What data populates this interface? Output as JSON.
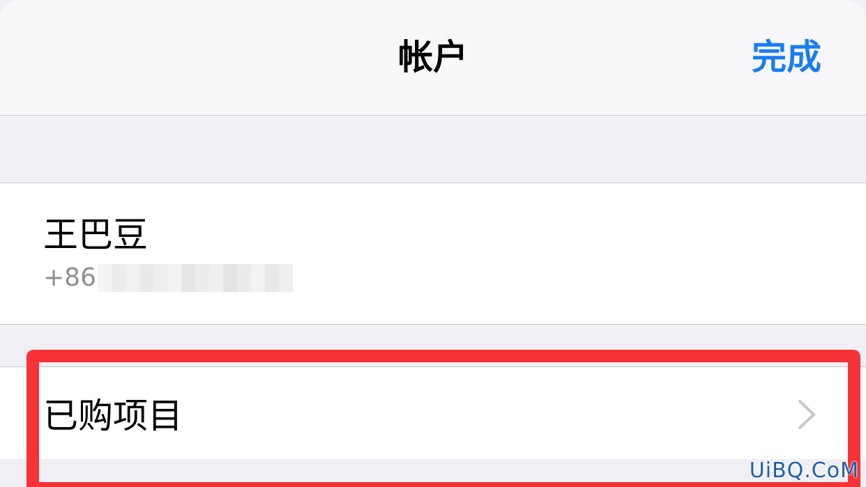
{
  "navbar": {
    "title": "帐户",
    "done_label": "完成"
  },
  "account": {
    "name": "王巴豆",
    "phone_prefix": "+86"
  },
  "purchased": {
    "label": "已购项目",
    "chevron_icon": "chevron-right-icon"
  },
  "colors": {
    "accent": "#1a7cf5",
    "highlight": "#f53236",
    "secondary_text": "#8e8e93"
  },
  "watermark": "UiBQ.CoM"
}
